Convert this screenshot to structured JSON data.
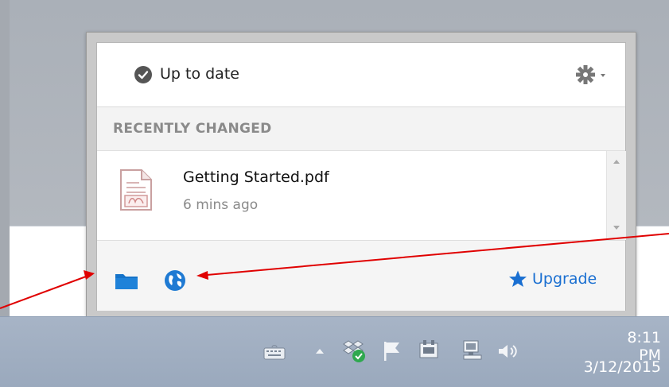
{
  "popup": {
    "status": {
      "text": "Up to date",
      "icon": "check-circle-icon"
    },
    "settings": {
      "icon": "gear-icon"
    },
    "section": {
      "title": "RECENTLY CHANGED"
    },
    "files": [
      {
        "name": "Getting Started.pdf",
        "time": "6 mins ago",
        "icon": "pdf-file-icon"
      }
    ],
    "footer": {
      "folder_icon": "folder-icon",
      "web_icon": "globe-icon",
      "upgrade_label": "Upgrade"
    }
  },
  "taskbar": {
    "tray_icons": [
      "keyboard-icon",
      "show-hidden-icons-arrow",
      "dropbox-icon",
      "action-center-flag-icon",
      "power-icon",
      "network-icon",
      "volume-icon"
    ],
    "clock": {
      "time": "8:11 PM",
      "date": "3/12/2015"
    }
  },
  "colors": {
    "accent": "#1a6fd1",
    "annotation_arrow": "#e00000"
  }
}
